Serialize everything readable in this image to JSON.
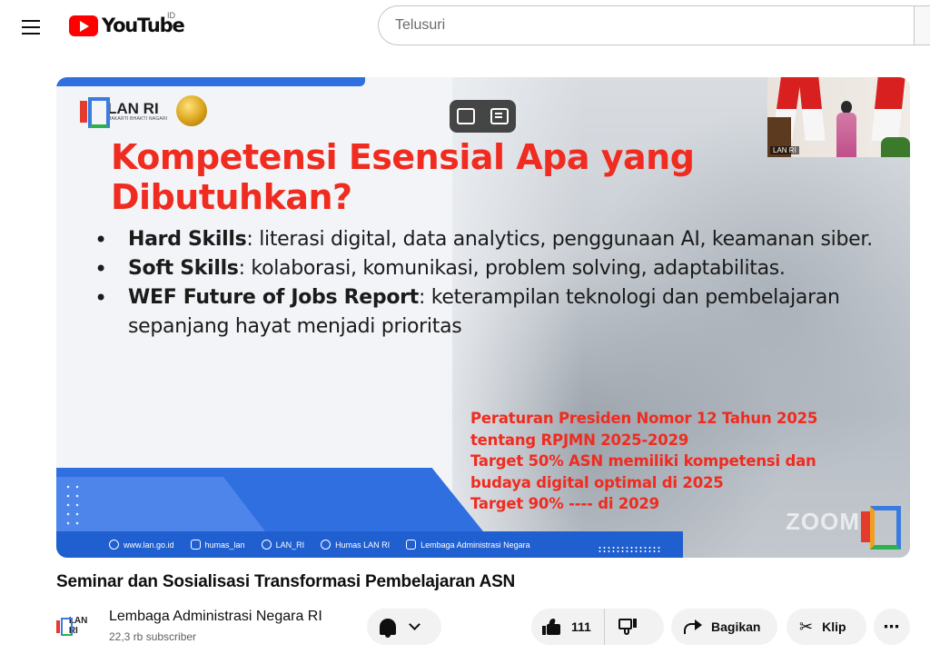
{
  "header": {
    "logo_text": "YouTube",
    "country_code": "ID",
    "search_placeholder": "Telusuri"
  },
  "video": {
    "slide": {
      "org_logo_text": "LAN RI",
      "org_logo_sub": "MAKARTI BHAKTI NAGARI",
      "title": "Kompetensi Esensial Apa yang Dibutuhkan?",
      "bullets": [
        {
          "bold": "Hard Skills",
          "text": ": literasi digital, data analytics, penggunaan AI, keamanan siber."
        },
        {
          "bold": "Soft Skills",
          "text": ": kolaborasi, komunikasi, problem solving, adaptabilitas."
        },
        {
          "bold": "WEF Future of Jobs Report",
          "text": ": keterampilan teknologi dan pembelajaran sepanjang hayat menjadi prioritas"
        }
      ],
      "red_note_lines": [
        "Peraturan Presiden Nomor 12 Tahun 2025",
        "tentang RPJMN 2025-2029",
        "Target 50% ASN memiliki kompetensi dan",
        "budaya digital optimal di 2025",
        "Target 90% ---- di 2029"
      ],
      "footer_links": [
        {
          "icon": "globe-icon",
          "label": "www.lan.go.id"
        },
        {
          "icon": "instagram-icon",
          "label": "humas_lan"
        },
        {
          "icon": "x-icon",
          "label": "LAN_RI"
        },
        {
          "icon": "facebook-icon",
          "label": "Humas LAN RI"
        },
        {
          "icon": "youtube-icon",
          "label": "Lembaga Administrasi Negara"
        }
      ],
      "speaker_label": "LAN RI",
      "watermark": "ZOOM"
    },
    "title": "Seminar dan Sosialisasi Transformasi Pembelajaran ASN"
  },
  "channel": {
    "avatar_text": "LAN RI",
    "name": "Lembaga Administrasi Negara RI",
    "subscribers": "22,3 rb subscriber"
  },
  "actions": {
    "like_count": "111",
    "share_label": "Bagikan",
    "clip_label": "Klip",
    "more_label": "⋯"
  },
  "colors": {
    "brand_red": "#ff0000",
    "slide_red": "#f02b1f",
    "slide_blue": "#2f6fe0"
  }
}
